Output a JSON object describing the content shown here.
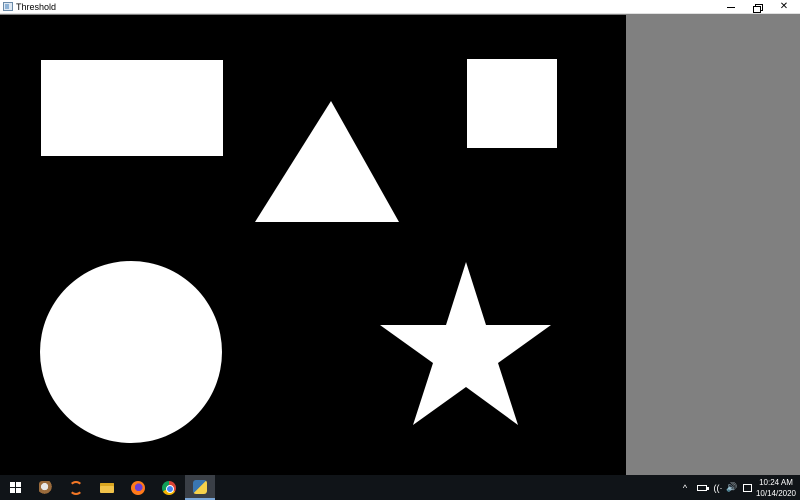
{
  "window": {
    "title": "Threshold",
    "controls": {
      "minimize_icon": "minimize-icon",
      "restore_icon": "restore-icon",
      "close_glyph": "✕"
    }
  },
  "image": {
    "background_color": "#000000",
    "foreground_color": "#ffffff",
    "shapes": [
      {
        "name": "rectangle"
      },
      {
        "name": "triangle"
      },
      {
        "name": "square"
      },
      {
        "name": "circle"
      },
      {
        "name": "star"
      }
    ]
  },
  "side_pane": {
    "color": "#808080"
  },
  "taskbar": {
    "items": [
      {
        "name": "start",
        "icon": "windows-logo-icon"
      },
      {
        "name": "paint",
        "icon": "paint-icon"
      },
      {
        "name": "jupyter",
        "icon": "jupyter-icon"
      },
      {
        "name": "file-explorer",
        "icon": "folder-icon"
      },
      {
        "name": "firefox",
        "icon": "firefox-icon"
      },
      {
        "name": "chrome",
        "icon": "chrome-icon"
      },
      {
        "name": "python",
        "icon": "python-icon",
        "active": true
      }
    ],
    "tray": {
      "chevron": "^",
      "volume_glyph": "🔊",
      "wifi_glyph": "((·",
      "time": "10:24 AM",
      "date": "10/14/2020"
    }
  }
}
